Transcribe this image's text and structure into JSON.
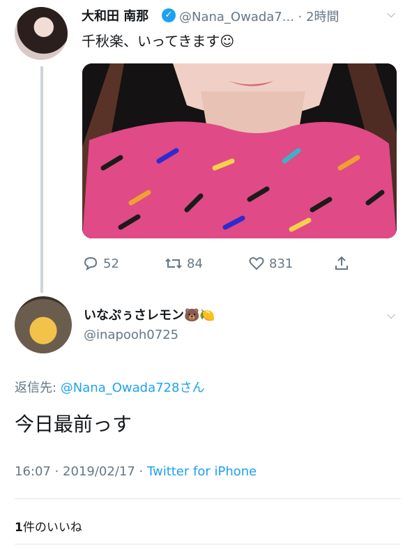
{
  "tweet": {
    "display_name": "大和田 南那",
    "handle": "@Nana_Owada7...",
    "time": "2時間",
    "text": "千秋楽、いってきます☺",
    "reply_count": "52",
    "retweet_count": "84",
    "like_count": "831"
  },
  "reply": {
    "display_name": "いなぷぅさレモン🐻🍋",
    "handle": "@inapooh0725",
    "reply_to_label": "返信先: ",
    "reply_to_handle": "@Nana_Owada728",
    "reply_to_suffix": "さん",
    "text": "今日最前っす",
    "timestamp": "16:07 · 2019/02/17 · ",
    "source": "Twitter for iPhone",
    "likes_count": "1",
    "likes_label": "件のいいね"
  },
  "colors": {
    "accent": "#1da1f2",
    "muted": "#657786"
  }
}
